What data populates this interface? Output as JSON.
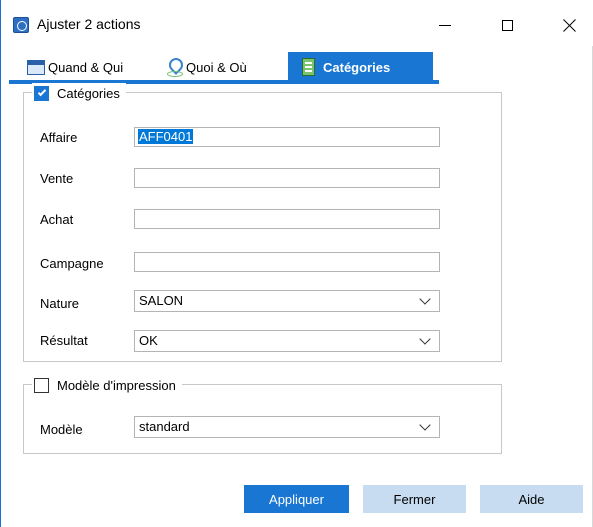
{
  "window": {
    "title": "Ajuster 2 actions"
  },
  "tabs": [
    {
      "label": "Quand & Qui",
      "icon": "calendar-icon"
    },
    {
      "label": "Quoi & Où",
      "icon": "map-pin-icon"
    },
    {
      "label": "Catégories",
      "icon": "category-icon",
      "active": true
    }
  ],
  "categories_group": {
    "legend": "Catégories",
    "checked": true,
    "fields": {
      "affaire": {
        "label": "Affaire",
        "value": "AFF0401"
      },
      "vente": {
        "label": "Vente",
        "value": ""
      },
      "achat": {
        "label": "Achat",
        "value": ""
      },
      "campagne": {
        "label": "Campagne",
        "value": ""
      },
      "nature": {
        "label": "Nature",
        "value": "SALON"
      },
      "resultat": {
        "label": "Résultat",
        "value": "OK"
      }
    }
  },
  "print_group": {
    "legend": "Modèle d'impression",
    "checked": false,
    "modele": {
      "label": "Modèle",
      "value": "standard"
    }
  },
  "buttons": {
    "apply": "Appliquer",
    "close": "Fermer",
    "help": "Aide"
  },
  "colors": {
    "accent": "#1976d2",
    "secondary_button": "#c7dcf1",
    "selection": "#0078d7"
  }
}
